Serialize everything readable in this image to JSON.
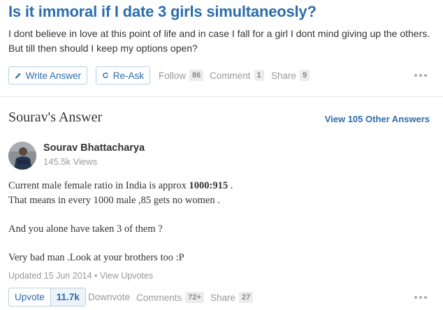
{
  "question": {
    "title": "Is it immoral if I date 3 girls simultaneosly?",
    "details": "I dont believe in love at this point of life and in case I fall for a girl I dont mind giving up the others. But till then should I keep my options open?"
  },
  "question_actions": {
    "write_answer": "Write Answer",
    "reask": "Re-Ask",
    "follow_label": "Follow",
    "follow_count": "86",
    "comment_label": "Comment",
    "comment_count": "1",
    "share_label": "Share",
    "share_count": "9"
  },
  "answer_section": {
    "heading": "Sourav's Answer",
    "view_other": "View 105 Other Answers"
  },
  "author": {
    "name": "Sourav Bhattacharya",
    "views": "145.5k Views"
  },
  "answer": {
    "line1_text": "Current male female ratio in India is approx ",
    "line1_bold": "1000:915",
    "line1_end": " .",
    "line2": "That means in every 1000 male ,85 gets no women .",
    "line3": "And you alone have taken 3 of them ?",
    "line4": "Very bad man .Look at your brothers too :P"
  },
  "meta": {
    "updated": "Updated 15 Jun 2014",
    "separator": "•",
    "view_upvotes": "View Upvotes"
  },
  "answer_actions": {
    "upvote_label": "Upvote",
    "upvote_count": "11.7k",
    "downvote": "Downvote",
    "comments_label": "Comments",
    "comments_count": "72+",
    "share_label": "Share",
    "share_count": "27"
  },
  "colors": {
    "link_blue": "#2b6dad",
    "muted": "#999999",
    "text": "#333333"
  }
}
